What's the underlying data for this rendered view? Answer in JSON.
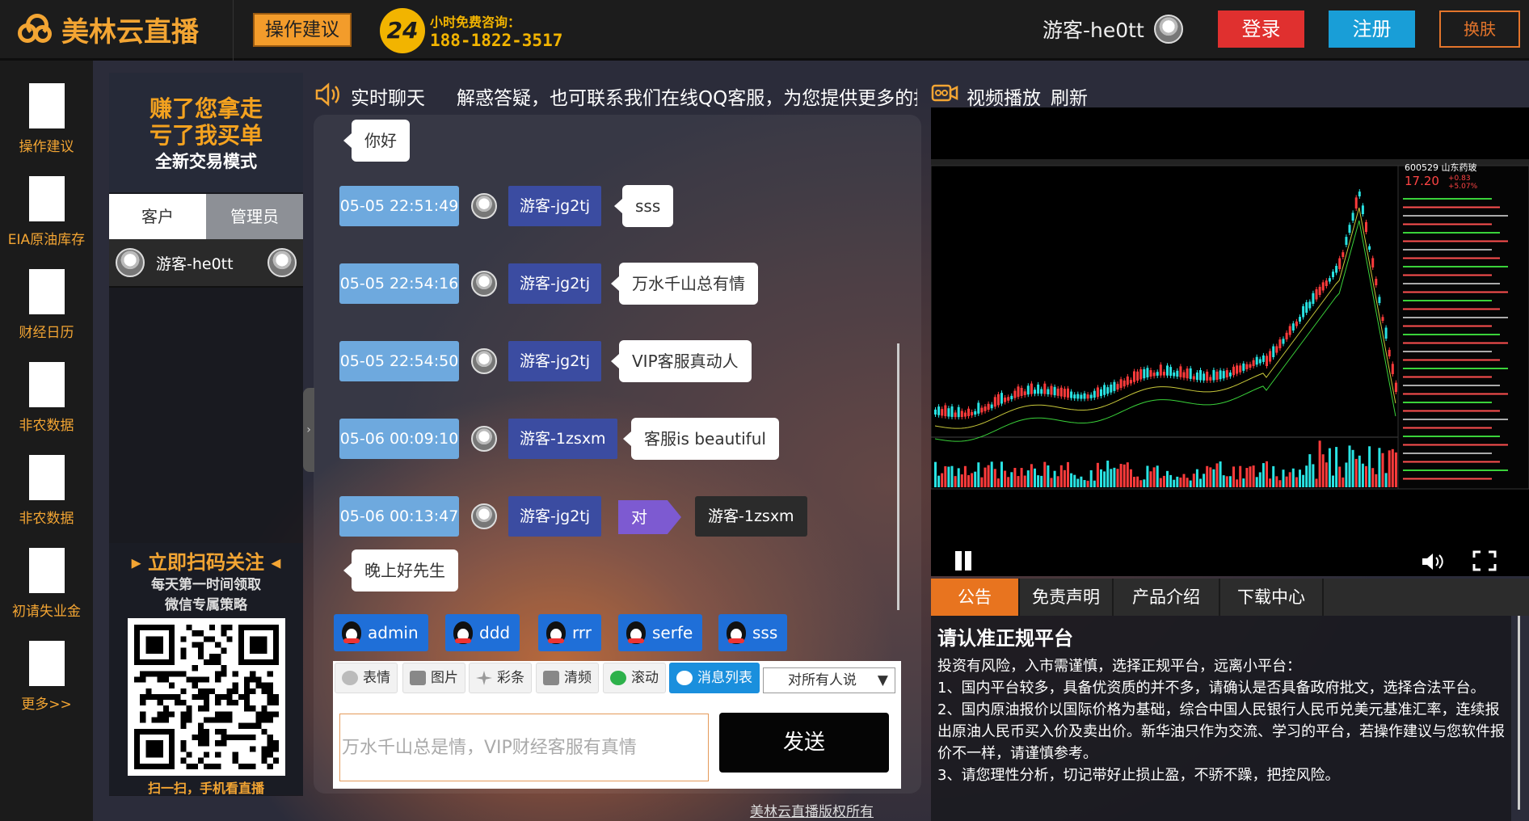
{
  "header": {
    "logo_text": "美林云直播",
    "suggest_label": "操作建议",
    "phone_line1": "小时免费咨询：",
    "phone_emblem": "24",
    "phone_number": "188-1822-3517",
    "username": "游客-he0tt",
    "login_label": "登录",
    "register_label": "注册",
    "skin_label": "换肤"
  },
  "leftnav": {
    "items": [
      {
        "label": "操作建议"
      },
      {
        "label": "EIA原油库存"
      },
      {
        "label": "财经日历"
      },
      {
        "label": "非农数据"
      },
      {
        "label": "非农数据"
      },
      {
        "label": "初请失业金"
      },
      {
        "label": "更多>>"
      }
    ]
  },
  "userpanel": {
    "promo_line1": "赚了您拿走",
    "promo_line2": "亏了我买单",
    "promo_line3": "全新交易模式",
    "tab_customer": "客户",
    "tab_admin": "管理员",
    "online_user": "游客-he0tt",
    "qr_title": "立即扫码关注",
    "qr_sub1": "每天第一时间领取",
    "qr_sub2": "微信专属策略",
    "qr_caption": "扫一扫，手机看直播"
  },
  "chat": {
    "title": "实时聊天",
    "marquee": "解惑答疑，也可联系我们在线QQ客服，为您提供更多的指",
    "first_message": "你好",
    "messages": [
      {
        "time": "05-05 22:51:49",
        "user": "游客-jg2tj",
        "text": "sss"
      },
      {
        "time": "05-05 22:54:16",
        "user": "游客-jg2tj",
        "text": "万水千山总有情"
      },
      {
        "time": "05-05 22:54:50",
        "user": "游客-jg2tj",
        "text": "VIP客服真动人"
      },
      {
        "time": "05-06 00:09:10",
        "user": "游客-1zsxm",
        "text": "客服is beautiful"
      },
      {
        "time": "05-06 00:13:47",
        "user": "游客-jg2tj",
        "to_label": "对",
        "to_user": "游客-1zsxm",
        "text": "晚上好先生"
      }
    ],
    "qq_services": [
      "admin",
      "ddd",
      "rrr",
      "serfe",
      "sss"
    ],
    "tools": {
      "emoji": "表情",
      "image": "图片",
      "colorbar": "彩条",
      "clear": "清频",
      "scroll": "滚动",
      "msglist": "消息列表"
    },
    "to_select": "对所有人说",
    "input_placeholder": "万水千山总是情，VIP财经客服有真情",
    "send_label": "发送",
    "copyright": "美林云直播版权所有"
  },
  "video": {
    "title": "视频播放",
    "refresh_label": "刷新",
    "stock_code": "600529 山东药玻",
    "stock_price": "17.20",
    "stock_change": "+0.83",
    "stock_pct": "+5.07%"
  },
  "notice": {
    "tabs": [
      "公告",
      "免责声明",
      "产品介绍",
      "下载中心"
    ],
    "title": "请认准正规平台",
    "lines": [
      "投资有风险，入市需谨慎，选择正规平台，远离小平台：",
      "1、国内平台较多，具备优资质的并不多，请确认是否具备政府批文，选择合法平台。",
      "2、国内原油报价以国际价格为基础，综合中国人民银行人民币兑美元基准汇率，连续报出原油人民币买入价及卖出价。新华油只作为交流、学习的平台，若操作建议与您软件报价不一样，请谨慎参考。",
      "3、请您理性分析，切记带好止损止盈，不骄不躁，把控风险。"
    ]
  },
  "colors": {
    "brand_orange": "#f3a533",
    "login_red": "#e0302f",
    "register_blue": "#199ed7",
    "timestamp_blue": "#6ea9de",
    "username_blue": "#3b4ca1",
    "qq_blue": "#1f6fd8"
  }
}
